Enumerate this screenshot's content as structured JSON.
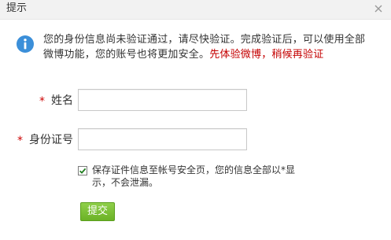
{
  "dialog": {
    "title": "提示",
    "close_icon": "close-icon"
  },
  "message": {
    "icon": "info-icon",
    "text": "您的身份信息尚未验证通过，请尽快验证。完成验证后，可以使用全部微博功能，您的账号也将更加安全。",
    "warning": "先体验微博，稍候再验证",
    "warning_color": "#c40000"
  },
  "form": {
    "name_required": "*",
    "name_label": "姓名",
    "name_value": "",
    "id_required": "*",
    "id_label": "身份证号",
    "id_value": "",
    "save_checked": true,
    "save_label": "保存证件信息至帐号安全页，您的信息全部以*显示，不会泄漏。",
    "submit_label": "提交",
    "submit_color": "#6bb226"
  }
}
